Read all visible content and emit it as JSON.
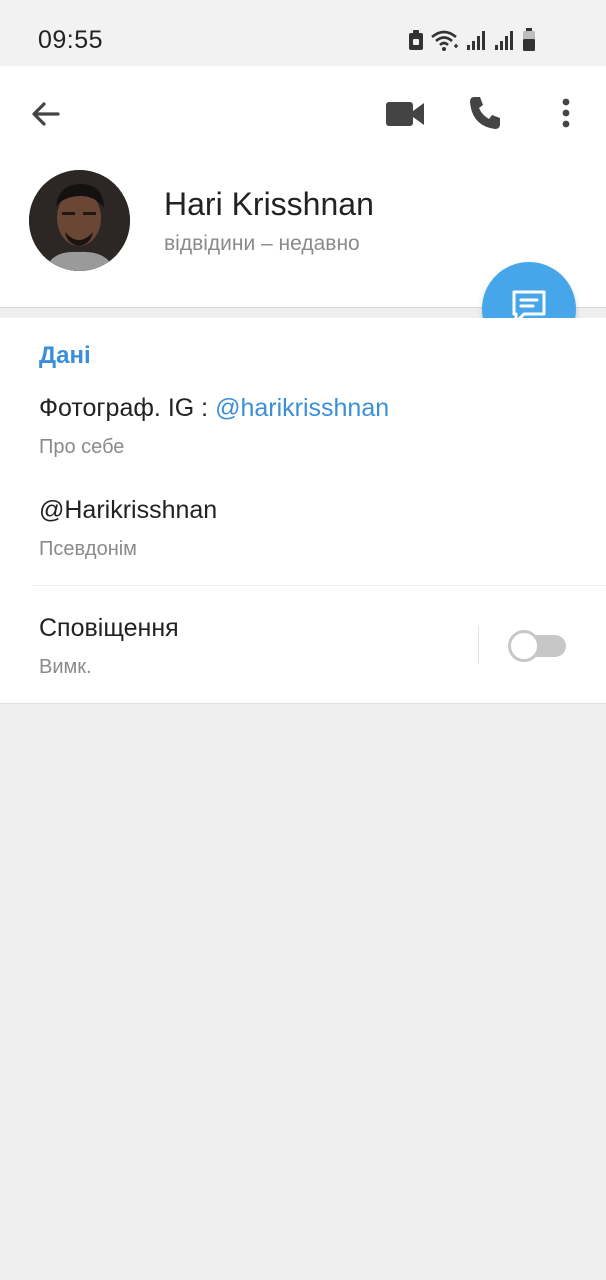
{
  "status_bar": {
    "time": "09:55",
    "icons": [
      "sim-lock-icon",
      "wifi-icon",
      "signal-icon",
      "signal-icon",
      "battery-icon"
    ]
  },
  "header": {
    "back_icon": "arrow-left-icon",
    "actions": [
      "video-camera-icon",
      "phone-icon",
      "more-vertical-icon"
    ]
  },
  "profile": {
    "name": "Hari Krisshnan",
    "status": "відвідини – недавно"
  },
  "fab": {
    "icon": "message-icon",
    "color": "#47a6ea"
  },
  "info": {
    "section_title": "Дані",
    "bio_prefix": "Фотограф. IG : ",
    "bio_link": "@harikrisshnan",
    "bio_caption": "Про себе",
    "username": "@Harikrisshnan",
    "username_caption": "Псевдонім",
    "notifications_title": "Сповіщення",
    "notifications_status": "Вимк.",
    "notifications_enabled": false
  },
  "colors": {
    "accent": "#3a8fd8",
    "fab": "#47a6ea",
    "background": "#efefef"
  }
}
